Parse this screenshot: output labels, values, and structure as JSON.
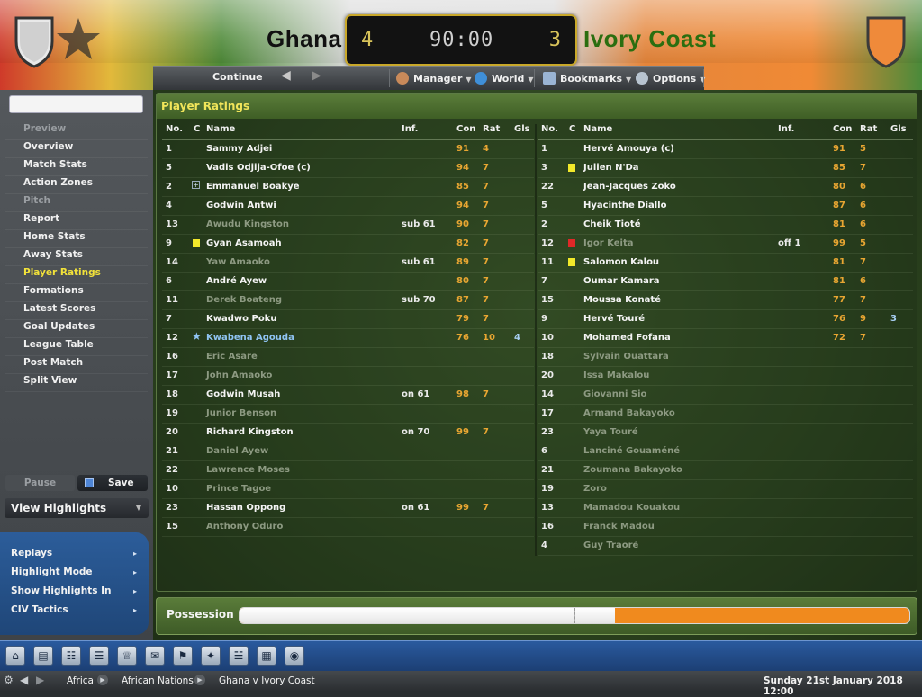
{
  "match": {
    "home_team": "Ghana",
    "away_team": "Ivory Coast",
    "home_score": "4",
    "away_score": "3",
    "clock": "90:00"
  },
  "navbar": {
    "continue_label": "Continue",
    "menus": [
      "Manager",
      "World",
      "Bookmarks",
      "Options"
    ]
  },
  "sidebar": {
    "items": [
      {
        "label": "Preview",
        "kind": "heading"
      },
      {
        "label": "Overview",
        "kind": "item"
      },
      {
        "label": "Match Stats",
        "kind": "item"
      },
      {
        "label": "Action Zones",
        "kind": "item"
      },
      {
        "label": "Pitch",
        "kind": "heading"
      },
      {
        "label": "Report",
        "kind": "item"
      },
      {
        "label": "Home Stats",
        "kind": "item"
      },
      {
        "label": "Away Stats",
        "kind": "item"
      },
      {
        "label": "Player Ratings",
        "kind": "active"
      },
      {
        "label": "Formations",
        "kind": "item"
      },
      {
        "label": "Latest Scores",
        "kind": "item"
      },
      {
        "label": "Goal Updates",
        "kind": "item"
      },
      {
        "label": "League Table",
        "kind": "item"
      },
      {
        "label": "Post Match",
        "kind": "item"
      },
      {
        "label": "Split View",
        "kind": "item"
      }
    ],
    "pause_label": "Pause",
    "save_label": "Save",
    "view_highlights_label": "View Highlights",
    "blue_items": [
      "Replays",
      "Highlight Mode",
      "Show Highlights In",
      "CIV Tactics"
    ]
  },
  "panel": {
    "title": "Player Ratings",
    "headers": {
      "no": "No.",
      "c": "C",
      "name": "Name",
      "inf": "Inf.",
      "con": "Con",
      "rat": "Rat",
      "gls": "Gls"
    }
  },
  "home_players": [
    {
      "no": "1",
      "name": "Sammy Adjei",
      "inf": "",
      "con": "91",
      "rat": "4",
      "gls": "",
      "status": "played",
      "icon": ""
    },
    {
      "no": "5",
      "name": "Vadis Odjija-Ofoe (c)",
      "inf": "",
      "con": "94",
      "rat": "7",
      "gls": "",
      "status": "played",
      "icon": ""
    },
    {
      "no": "2",
      "name": "Emmanuel Boakye",
      "inf": "",
      "con": "85",
      "rat": "7",
      "gls": "",
      "status": "played",
      "icon": "medical"
    },
    {
      "no": "4",
      "name": "Godwin Antwi",
      "inf": "",
      "con": "94",
      "rat": "7",
      "gls": "",
      "status": "played",
      "icon": ""
    },
    {
      "no": "13",
      "name": "Awudu Kingston",
      "inf": "sub 61",
      "con": "90",
      "rat": "7",
      "gls": "",
      "status": "subbed",
      "icon": ""
    },
    {
      "no": "9",
      "name": "Gyan Asamoah",
      "inf": "",
      "con": "82",
      "rat": "7",
      "gls": "",
      "status": "played",
      "icon": "yellow"
    },
    {
      "no": "14",
      "name": "Yaw Amaoko",
      "inf": "sub 61",
      "con": "89",
      "rat": "7",
      "gls": "",
      "status": "subbed",
      "icon": ""
    },
    {
      "no": "6",
      "name": "André Ayew",
      "inf": "",
      "con": "80",
      "rat": "7",
      "gls": "",
      "status": "played",
      "icon": ""
    },
    {
      "no": "11",
      "name": "Derek Boateng",
      "inf": "sub 70",
      "con": "87",
      "rat": "7",
      "gls": "",
      "status": "subbed",
      "icon": ""
    },
    {
      "no": "7",
      "name": "Kwadwo Poku",
      "inf": "",
      "con": "79",
      "rat": "7",
      "gls": "",
      "status": "played",
      "icon": ""
    },
    {
      "no": "12",
      "name": "Kwabena Agouda",
      "inf": "",
      "con": "76",
      "rat": "10",
      "gls": "4",
      "status": "star",
      "icon": "star"
    },
    {
      "no": "16",
      "name": "Eric Asare",
      "inf": "",
      "con": "",
      "rat": "",
      "gls": "",
      "status": "unused",
      "icon": ""
    },
    {
      "no": "17",
      "name": "John Amaoko",
      "inf": "",
      "con": "",
      "rat": "",
      "gls": "",
      "status": "unused",
      "icon": ""
    },
    {
      "no": "18",
      "name": "Godwin Musah",
      "inf": "on 61",
      "con": "98",
      "rat": "7",
      "gls": "",
      "status": "played",
      "icon": ""
    },
    {
      "no": "19",
      "name": "Junior Benson",
      "inf": "",
      "con": "",
      "rat": "",
      "gls": "",
      "status": "unused",
      "icon": ""
    },
    {
      "no": "20",
      "name": "Richard Kingston",
      "inf": "on 70",
      "con": "99",
      "rat": "7",
      "gls": "",
      "status": "played",
      "icon": ""
    },
    {
      "no": "21",
      "name": "Daniel Ayew",
      "inf": "",
      "con": "",
      "rat": "",
      "gls": "",
      "status": "unused",
      "icon": ""
    },
    {
      "no": "22",
      "name": "Lawrence Moses",
      "inf": "",
      "con": "",
      "rat": "",
      "gls": "",
      "status": "unused",
      "icon": ""
    },
    {
      "no": "10",
      "name": "Prince Tagoe",
      "inf": "",
      "con": "",
      "rat": "",
      "gls": "",
      "status": "unused",
      "icon": ""
    },
    {
      "no": "23",
      "name": "Hassan Oppong",
      "inf": "on 61",
      "con": "99",
      "rat": "7",
      "gls": "",
      "status": "played",
      "icon": ""
    },
    {
      "no": "15",
      "name": "Anthony Oduro",
      "inf": "",
      "con": "",
      "rat": "",
      "gls": "",
      "status": "unused",
      "icon": ""
    }
  ],
  "away_players": [
    {
      "no": "1",
      "name": "Hervé Amouya (c)",
      "inf": "",
      "con": "91",
      "rat": "5",
      "gls": "",
      "status": "played",
      "icon": ""
    },
    {
      "no": "3",
      "name": "Julien N'Da",
      "inf": "",
      "con": "85",
      "rat": "7",
      "gls": "",
      "status": "played",
      "icon": "yellow"
    },
    {
      "no": "22",
      "name": "Jean-Jacques Zoko",
      "inf": "",
      "con": "80",
      "rat": "6",
      "gls": "",
      "status": "played",
      "icon": ""
    },
    {
      "no": "5",
      "name": "Hyacinthe Diallo",
      "inf": "",
      "con": "87",
      "rat": "6",
      "gls": "",
      "status": "played",
      "icon": ""
    },
    {
      "no": "2",
      "name": "Cheik Tioté",
      "inf": "",
      "con": "81",
      "rat": "6",
      "gls": "",
      "status": "played",
      "icon": ""
    },
    {
      "no": "12",
      "name": "Igor Keita",
      "inf": "off 1",
      "con": "99",
      "rat": "5",
      "gls": "",
      "status": "subbed",
      "icon": "red"
    },
    {
      "no": "11",
      "name": "Salomon Kalou",
      "inf": "",
      "con": "81",
      "rat": "7",
      "gls": "",
      "status": "played",
      "icon": "yellow"
    },
    {
      "no": "7",
      "name": "Oumar Kamara",
      "inf": "",
      "con": "81",
      "rat": "6",
      "gls": "",
      "status": "played",
      "icon": ""
    },
    {
      "no": "15",
      "name": "Moussa Konaté",
      "inf": "",
      "con": "77",
      "rat": "7",
      "gls": "",
      "status": "played",
      "icon": ""
    },
    {
      "no": "9",
      "name": "Hervé Touré",
      "inf": "",
      "con": "76",
      "rat": "9",
      "gls": "3",
      "status": "played",
      "icon": ""
    },
    {
      "no": "10",
      "name": "Mohamed Fofana",
      "inf": "",
      "con": "72",
      "rat": "7",
      "gls": "",
      "status": "played",
      "icon": ""
    },
    {
      "no": "18",
      "name": "Sylvain Ouattara",
      "inf": "",
      "con": "",
      "rat": "",
      "gls": "",
      "status": "unused",
      "icon": ""
    },
    {
      "no": "20",
      "name": "Issa Makalou",
      "inf": "",
      "con": "",
      "rat": "",
      "gls": "",
      "status": "unused",
      "icon": ""
    },
    {
      "no": "14",
      "name": "Giovanni Sio",
      "inf": "",
      "con": "",
      "rat": "",
      "gls": "",
      "status": "unused",
      "icon": ""
    },
    {
      "no": "17",
      "name": "Armand Bakayoko",
      "inf": "",
      "con": "",
      "rat": "",
      "gls": "",
      "status": "unused",
      "icon": ""
    },
    {
      "no": "23",
      "name": "Yaya Touré",
      "inf": "",
      "con": "",
      "rat": "",
      "gls": "",
      "status": "unused",
      "icon": ""
    },
    {
      "no": "6",
      "name": "Lanciné Gouaméné",
      "inf": "",
      "con": "",
      "rat": "",
      "gls": "",
      "status": "unused",
      "icon": ""
    },
    {
      "no": "21",
      "name": "Zoumana Bakayoko",
      "inf": "",
      "con": "",
      "rat": "",
      "gls": "",
      "status": "unused",
      "icon": ""
    },
    {
      "no": "19",
      "name": "Zoro",
      "inf": "",
      "con": "",
      "rat": "",
      "gls": "",
      "status": "unused",
      "icon": ""
    },
    {
      "no": "13",
      "name": "Mamadou Kouakou",
      "inf": "",
      "con": "",
      "rat": "",
      "gls": "",
      "status": "unused",
      "icon": ""
    },
    {
      "no": "16",
      "name": "Franck Madou",
      "inf": "",
      "con": "",
      "rat": "",
      "gls": "",
      "status": "unused",
      "icon": ""
    },
    {
      "no": "4",
      "name": "Guy Traoré",
      "inf": "",
      "con": "",
      "rat": "",
      "gls": "",
      "status": "unused",
      "icon": ""
    }
  ],
  "possession": {
    "label": "Possession",
    "home_fraction": 0.56
  },
  "statusbar": {
    "crumbs": [
      "Africa",
      "African Nations",
      "Ghana v Ivory Coast"
    ],
    "date": "Sunday 21st January 2018 12:00"
  },
  "toolbar_icons": [
    "home-icon",
    "inbox-icon",
    "squad-icon",
    "fixtures-icon",
    "trophy-icon",
    "news-icon",
    "tactics-icon",
    "scouting-icon",
    "finances-icon",
    "board-icon",
    "world-icon"
  ],
  "colors": {
    "accent_yellow": "#f1e55a",
    "rating_orange": "#e8a632",
    "away_orange": "#f08a1e",
    "toolbar_blue": "#2a5a9e"
  }
}
